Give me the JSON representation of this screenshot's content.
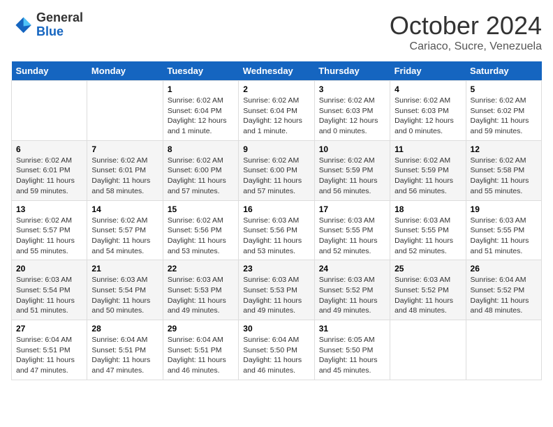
{
  "logo": {
    "general": "General",
    "blue": "Blue"
  },
  "header": {
    "month": "October 2024",
    "location": "Cariaco, Sucre, Venezuela"
  },
  "days_of_week": [
    "Sunday",
    "Monday",
    "Tuesday",
    "Wednesday",
    "Thursday",
    "Friday",
    "Saturday"
  ],
  "weeks": [
    [
      {
        "day": "",
        "info": ""
      },
      {
        "day": "",
        "info": ""
      },
      {
        "day": "1",
        "info": "Sunrise: 6:02 AM\nSunset: 6:04 PM\nDaylight: 12 hours and 1 minute."
      },
      {
        "day": "2",
        "info": "Sunrise: 6:02 AM\nSunset: 6:04 PM\nDaylight: 12 hours and 1 minute."
      },
      {
        "day": "3",
        "info": "Sunrise: 6:02 AM\nSunset: 6:03 PM\nDaylight: 12 hours and 0 minutes."
      },
      {
        "day": "4",
        "info": "Sunrise: 6:02 AM\nSunset: 6:03 PM\nDaylight: 12 hours and 0 minutes."
      },
      {
        "day": "5",
        "info": "Sunrise: 6:02 AM\nSunset: 6:02 PM\nDaylight: 11 hours and 59 minutes."
      }
    ],
    [
      {
        "day": "6",
        "info": "Sunrise: 6:02 AM\nSunset: 6:01 PM\nDaylight: 11 hours and 59 minutes."
      },
      {
        "day": "7",
        "info": "Sunrise: 6:02 AM\nSunset: 6:01 PM\nDaylight: 11 hours and 58 minutes."
      },
      {
        "day": "8",
        "info": "Sunrise: 6:02 AM\nSunset: 6:00 PM\nDaylight: 11 hours and 57 minutes."
      },
      {
        "day": "9",
        "info": "Sunrise: 6:02 AM\nSunset: 6:00 PM\nDaylight: 11 hours and 57 minutes."
      },
      {
        "day": "10",
        "info": "Sunrise: 6:02 AM\nSunset: 5:59 PM\nDaylight: 11 hours and 56 minutes."
      },
      {
        "day": "11",
        "info": "Sunrise: 6:02 AM\nSunset: 5:59 PM\nDaylight: 11 hours and 56 minutes."
      },
      {
        "day": "12",
        "info": "Sunrise: 6:02 AM\nSunset: 5:58 PM\nDaylight: 11 hours and 55 minutes."
      }
    ],
    [
      {
        "day": "13",
        "info": "Sunrise: 6:02 AM\nSunset: 5:57 PM\nDaylight: 11 hours and 55 minutes."
      },
      {
        "day": "14",
        "info": "Sunrise: 6:02 AM\nSunset: 5:57 PM\nDaylight: 11 hours and 54 minutes."
      },
      {
        "day": "15",
        "info": "Sunrise: 6:02 AM\nSunset: 5:56 PM\nDaylight: 11 hours and 53 minutes."
      },
      {
        "day": "16",
        "info": "Sunrise: 6:03 AM\nSunset: 5:56 PM\nDaylight: 11 hours and 53 minutes."
      },
      {
        "day": "17",
        "info": "Sunrise: 6:03 AM\nSunset: 5:55 PM\nDaylight: 11 hours and 52 minutes."
      },
      {
        "day": "18",
        "info": "Sunrise: 6:03 AM\nSunset: 5:55 PM\nDaylight: 11 hours and 52 minutes."
      },
      {
        "day": "19",
        "info": "Sunrise: 6:03 AM\nSunset: 5:55 PM\nDaylight: 11 hours and 51 minutes."
      }
    ],
    [
      {
        "day": "20",
        "info": "Sunrise: 6:03 AM\nSunset: 5:54 PM\nDaylight: 11 hours and 51 minutes."
      },
      {
        "day": "21",
        "info": "Sunrise: 6:03 AM\nSunset: 5:54 PM\nDaylight: 11 hours and 50 minutes."
      },
      {
        "day": "22",
        "info": "Sunrise: 6:03 AM\nSunset: 5:53 PM\nDaylight: 11 hours and 49 minutes."
      },
      {
        "day": "23",
        "info": "Sunrise: 6:03 AM\nSunset: 5:53 PM\nDaylight: 11 hours and 49 minutes."
      },
      {
        "day": "24",
        "info": "Sunrise: 6:03 AM\nSunset: 5:52 PM\nDaylight: 11 hours and 49 minutes."
      },
      {
        "day": "25",
        "info": "Sunrise: 6:03 AM\nSunset: 5:52 PM\nDaylight: 11 hours and 48 minutes."
      },
      {
        "day": "26",
        "info": "Sunrise: 6:04 AM\nSunset: 5:52 PM\nDaylight: 11 hours and 48 minutes."
      }
    ],
    [
      {
        "day": "27",
        "info": "Sunrise: 6:04 AM\nSunset: 5:51 PM\nDaylight: 11 hours and 47 minutes."
      },
      {
        "day": "28",
        "info": "Sunrise: 6:04 AM\nSunset: 5:51 PM\nDaylight: 11 hours and 47 minutes."
      },
      {
        "day": "29",
        "info": "Sunrise: 6:04 AM\nSunset: 5:51 PM\nDaylight: 11 hours and 46 minutes."
      },
      {
        "day": "30",
        "info": "Sunrise: 6:04 AM\nSunset: 5:50 PM\nDaylight: 11 hours and 46 minutes."
      },
      {
        "day": "31",
        "info": "Sunrise: 6:05 AM\nSunset: 5:50 PM\nDaylight: 11 hours and 45 minutes."
      },
      {
        "day": "",
        "info": ""
      },
      {
        "day": "",
        "info": ""
      }
    ]
  ]
}
